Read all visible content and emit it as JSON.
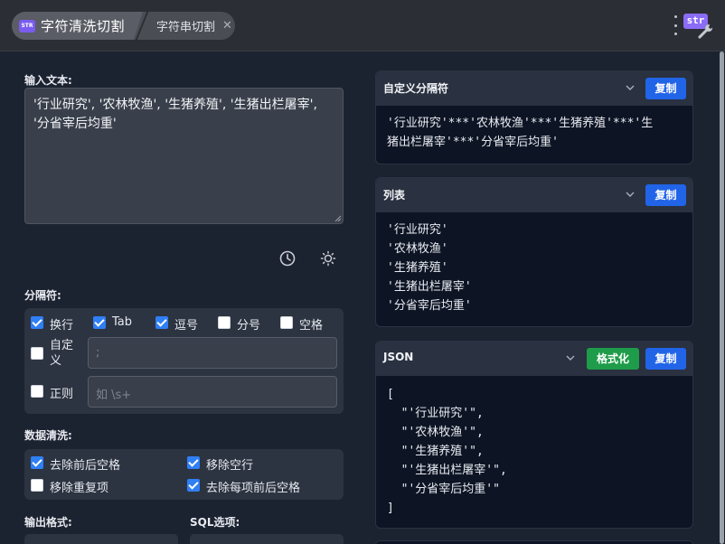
{
  "header": {
    "active_tab": "字符清洗切割",
    "second_tab": "字符串切割",
    "close_glyph": "✕",
    "app_icon_text": "STR",
    "logo_text": "str"
  },
  "input": {
    "label": "输入文本:",
    "value": "'行业研究', '农林牧渔', '生猪养殖', '生猪出栏屠宰', '分省宰后均重'"
  },
  "separator": {
    "label": "分隔符:",
    "options": [
      {
        "label": "换行",
        "checked": true
      },
      {
        "label": "Tab",
        "checked": true
      },
      {
        "label": "逗号",
        "checked": true
      },
      {
        "label": "分号",
        "checked": false
      },
      {
        "label": "空格",
        "checked": false
      }
    ],
    "custom_label": "自定义",
    "custom_placeholder": ";",
    "regex_label": "正则",
    "regex_placeholder": "如 \\s+"
  },
  "cleaning": {
    "label": "数据清洗:",
    "options": [
      {
        "label": "去除前后空格",
        "checked": true
      },
      {
        "label": "移除空行",
        "checked": true
      },
      {
        "label": "移除重复项",
        "checked": false
      },
      {
        "label": "去除每项前后空格",
        "checked": true
      }
    ]
  },
  "output": {
    "format_label": "输出格式:",
    "sql_label": "SQL选项:"
  },
  "cards": {
    "custom": {
      "title": "自定义分隔符",
      "copy": "复制",
      "content": "'行业研究'***'农林牧渔'***'生猪养殖'***'生\n猪出栏屠宰'***'分省宰后均重'"
    },
    "list": {
      "title": "列表",
      "copy": "复制",
      "content": "'行业研究'\n'农林牧渔'\n'生猪养殖'\n'生猪出栏屠宰'\n'分省宰后均重'"
    },
    "json": {
      "title": "JSON",
      "format": "格式化",
      "copy": "复制",
      "content": "[\n  \"'行业研究'\",\n  \"'农林牧渔'\",\n  \"'生猪养殖'\",\n  \"'生猪出栏屠宰'\",\n  \"'分省宰后均重'\"\n]"
    }
  },
  "colors": {
    "accent_blue": "#2164e8",
    "accent_green": "#1e9c4a",
    "checkbox_on": "#2f7ff5"
  },
  "icons": {
    "history": "clock-icon",
    "theme": "sun-icon",
    "menu": "more-vertical-icon",
    "tool": "wrench-icon"
  }
}
